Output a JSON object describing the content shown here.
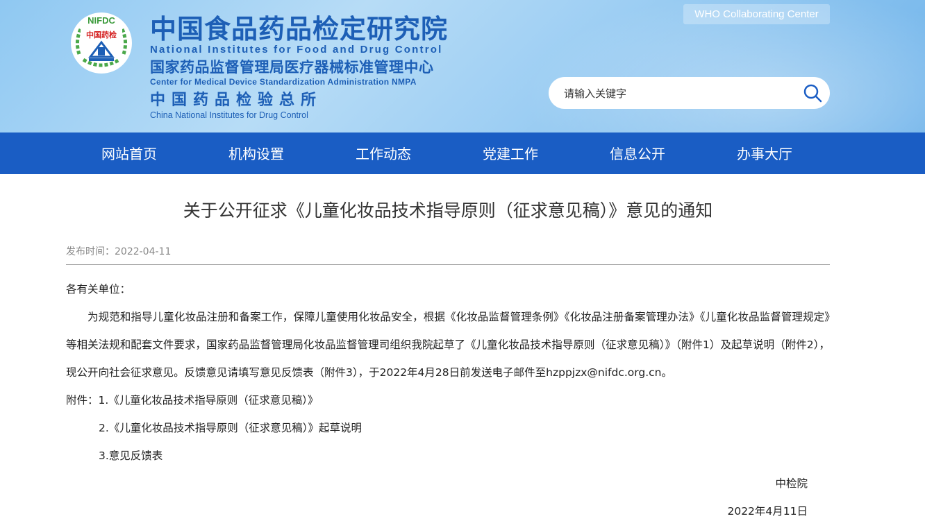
{
  "header": {
    "logo_text_top": "NIFDC",
    "logo_text_mid": "中国药检",
    "title_cn": "中国食品药品检定研究院",
    "title_en": "National Institutes for Food and Drug Control",
    "subtitle1_cn": "国家药品监督管理局医疗器械标准管理中心",
    "subtitle1_en": "Center for Medical Device Standardization Administration NMPA",
    "subtitle2_cn": "中国药品检验总所",
    "subtitle2_en": "China National Institutes for Drug Control",
    "who_label": "WHO Collaborating Center",
    "search_placeholder": "请输入关键字"
  },
  "nav": {
    "items": [
      "网站首页",
      "机构设置",
      "工作动态",
      "党建工作",
      "信息公开",
      "办事大厅"
    ]
  },
  "article": {
    "title": "关于公开征求《儿童化妆品技术指导原则（征求意见稿）》意见的通知",
    "publish_label": "发布时间：",
    "publish_date": "2022-04-11",
    "salutation": "各有关单位：",
    "body": "为规范和指导儿童化妆品注册和备案工作，保障儿童使用化妆品安全，根据《化妆品监督管理条例》《化妆品注册备案管理办法》《儿童化妆品监督管理规定》等相关法规和配套文件要求，国家药品监督管理局化妆品监督管理司组织我院起草了《儿童化妆品技术指导原则（征求意见稿）》（附件1）及起草说明（附件2），现公开向社会征求意见。反馈意见请填写意见反馈表（附件3），于2022年4月28日前发送电子邮件至hzppjzx@nifdc.org.cn。",
    "attachments_label": "附件：",
    "attachments": [
      "1.《儿童化妆品技术指导原则（征求意见稿）》",
      "2.《儿童化妆品技术指导原则（征求意见稿）》起草说明",
      "3.意见反馈表"
    ],
    "signature": "中检院",
    "sign_date": "2022年4月11日"
  },
  "colors": {
    "nav_bg": "#1a5dc4",
    "title_blue": "#1d5fb6",
    "header_bg": "#9dcef3"
  }
}
